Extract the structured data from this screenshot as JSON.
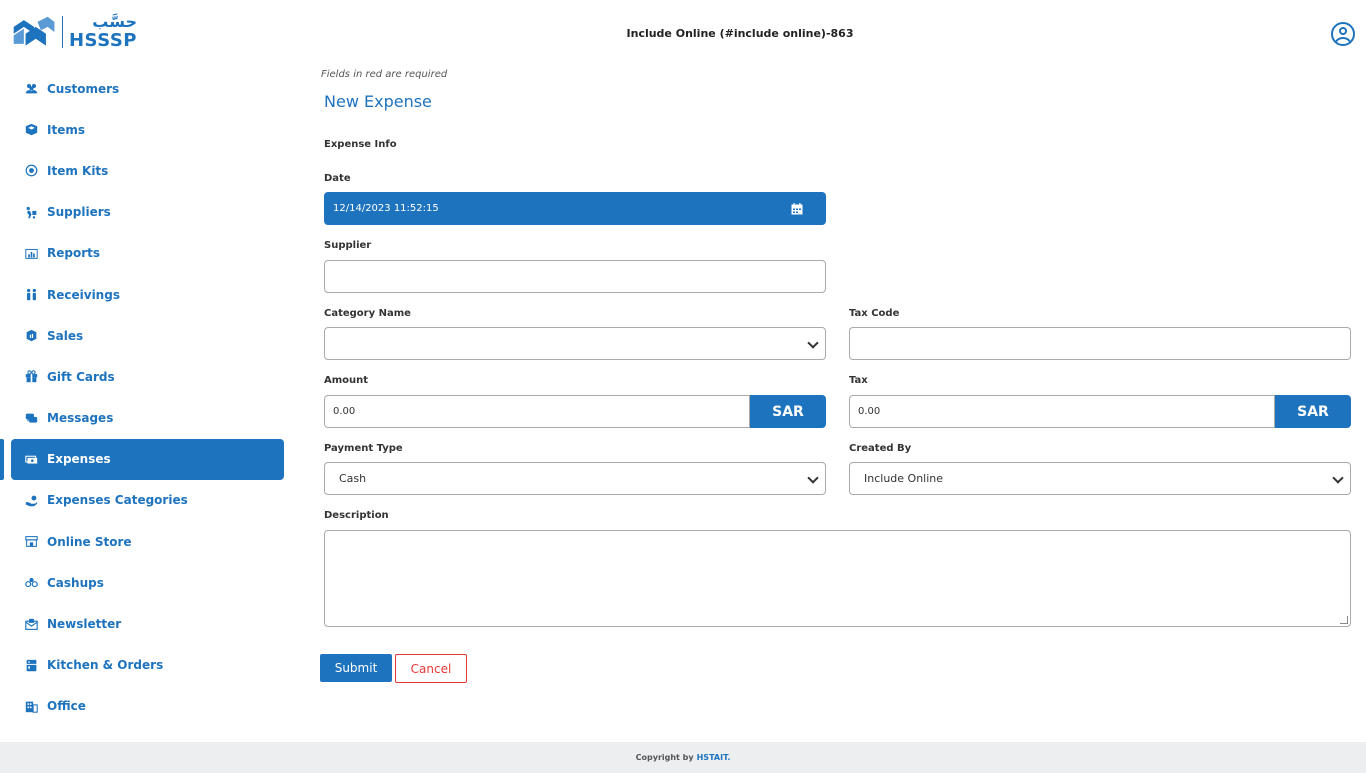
{
  "header": {
    "logo_arabic": "حسَّب",
    "logo_text": "HSSSP",
    "title": "Include Online (#include online)-863"
  },
  "sidebar": {
    "items": [
      {
        "label": "Customers",
        "icon": "users-icon"
      },
      {
        "label": "Items",
        "icon": "box-icon"
      },
      {
        "label": "Item Kits",
        "icon": "target-icon"
      },
      {
        "label": "Suppliers",
        "icon": "dolly-icon"
      },
      {
        "label": "Reports",
        "icon": "chart-icon"
      },
      {
        "label": "Receivings",
        "icon": "people-icon"
      },
      {
        "label": "Sales",
        "icon": "shopping-bag-icon"
      },
      {
        "label": "Gift Cards",
        "icon": "gift-icon"
      },
      {
        "label": "Messages",
        "icon": "comments-icon"
      },
      {
        "label": "Expenses",
        "icon": "money-icon",
        "active": true
      },
      {
        "label": "Expenses Categories",
        "icon": "hand-coin-icon"
      },
      {
        "label": "Online Store",
        "icon": "store-icon"
      },
      {
        "label": "Cashups",
        "icon": "coins-icon"
      },
      {
        "label": "Newsletter",
        "icon": "envelope-icon"
      },
      {
        "label": "Kitchen & Orders",
        "icon": "kitchen-icon"
      },
      {
        "label": "Office",
        "icon": "building-icon"
      }
    ]
  },
  "form": {
    "required_note": "Fields in red are required",
    "title": "New Expense",
    "section": "Expense Info",
    "date_label": "Date",
    "date_value": "12/14/2023 11:52:15",
    "supplier_label": "Supplier",
    "supplier_value": "",
    "category_label": "Category Name",
    "category_value": "",
    "tax_code_label": "Tax Code",
    "tax_code_value": "",
    "amount_label": "Amount",
    "amount_value": "0.00",
    "amount_currency": "SAR",
    "tax_label": "Tax",
    "tax_value": "0.00",
    "tax_currency": "SAR",
    "payment_type_label": "Payment Type",
    "payment_type_value": "Cash",
    "created_by_label": "Created By",
    "created_by_value": "Include Online",
    "description_label": "Description",
    "description_value": "",
    "submit_label": "Submit",
    "cancel_label": "Cancel"
  },
  "footer": {
    "copyright": "Copyright by",
    "brand": "HSTAIT."
  },
  "colors": {
    "primary": "#1e73be",
    "danger": "#e53935",
    "footer_bg": "#eceeef"
  }
}
